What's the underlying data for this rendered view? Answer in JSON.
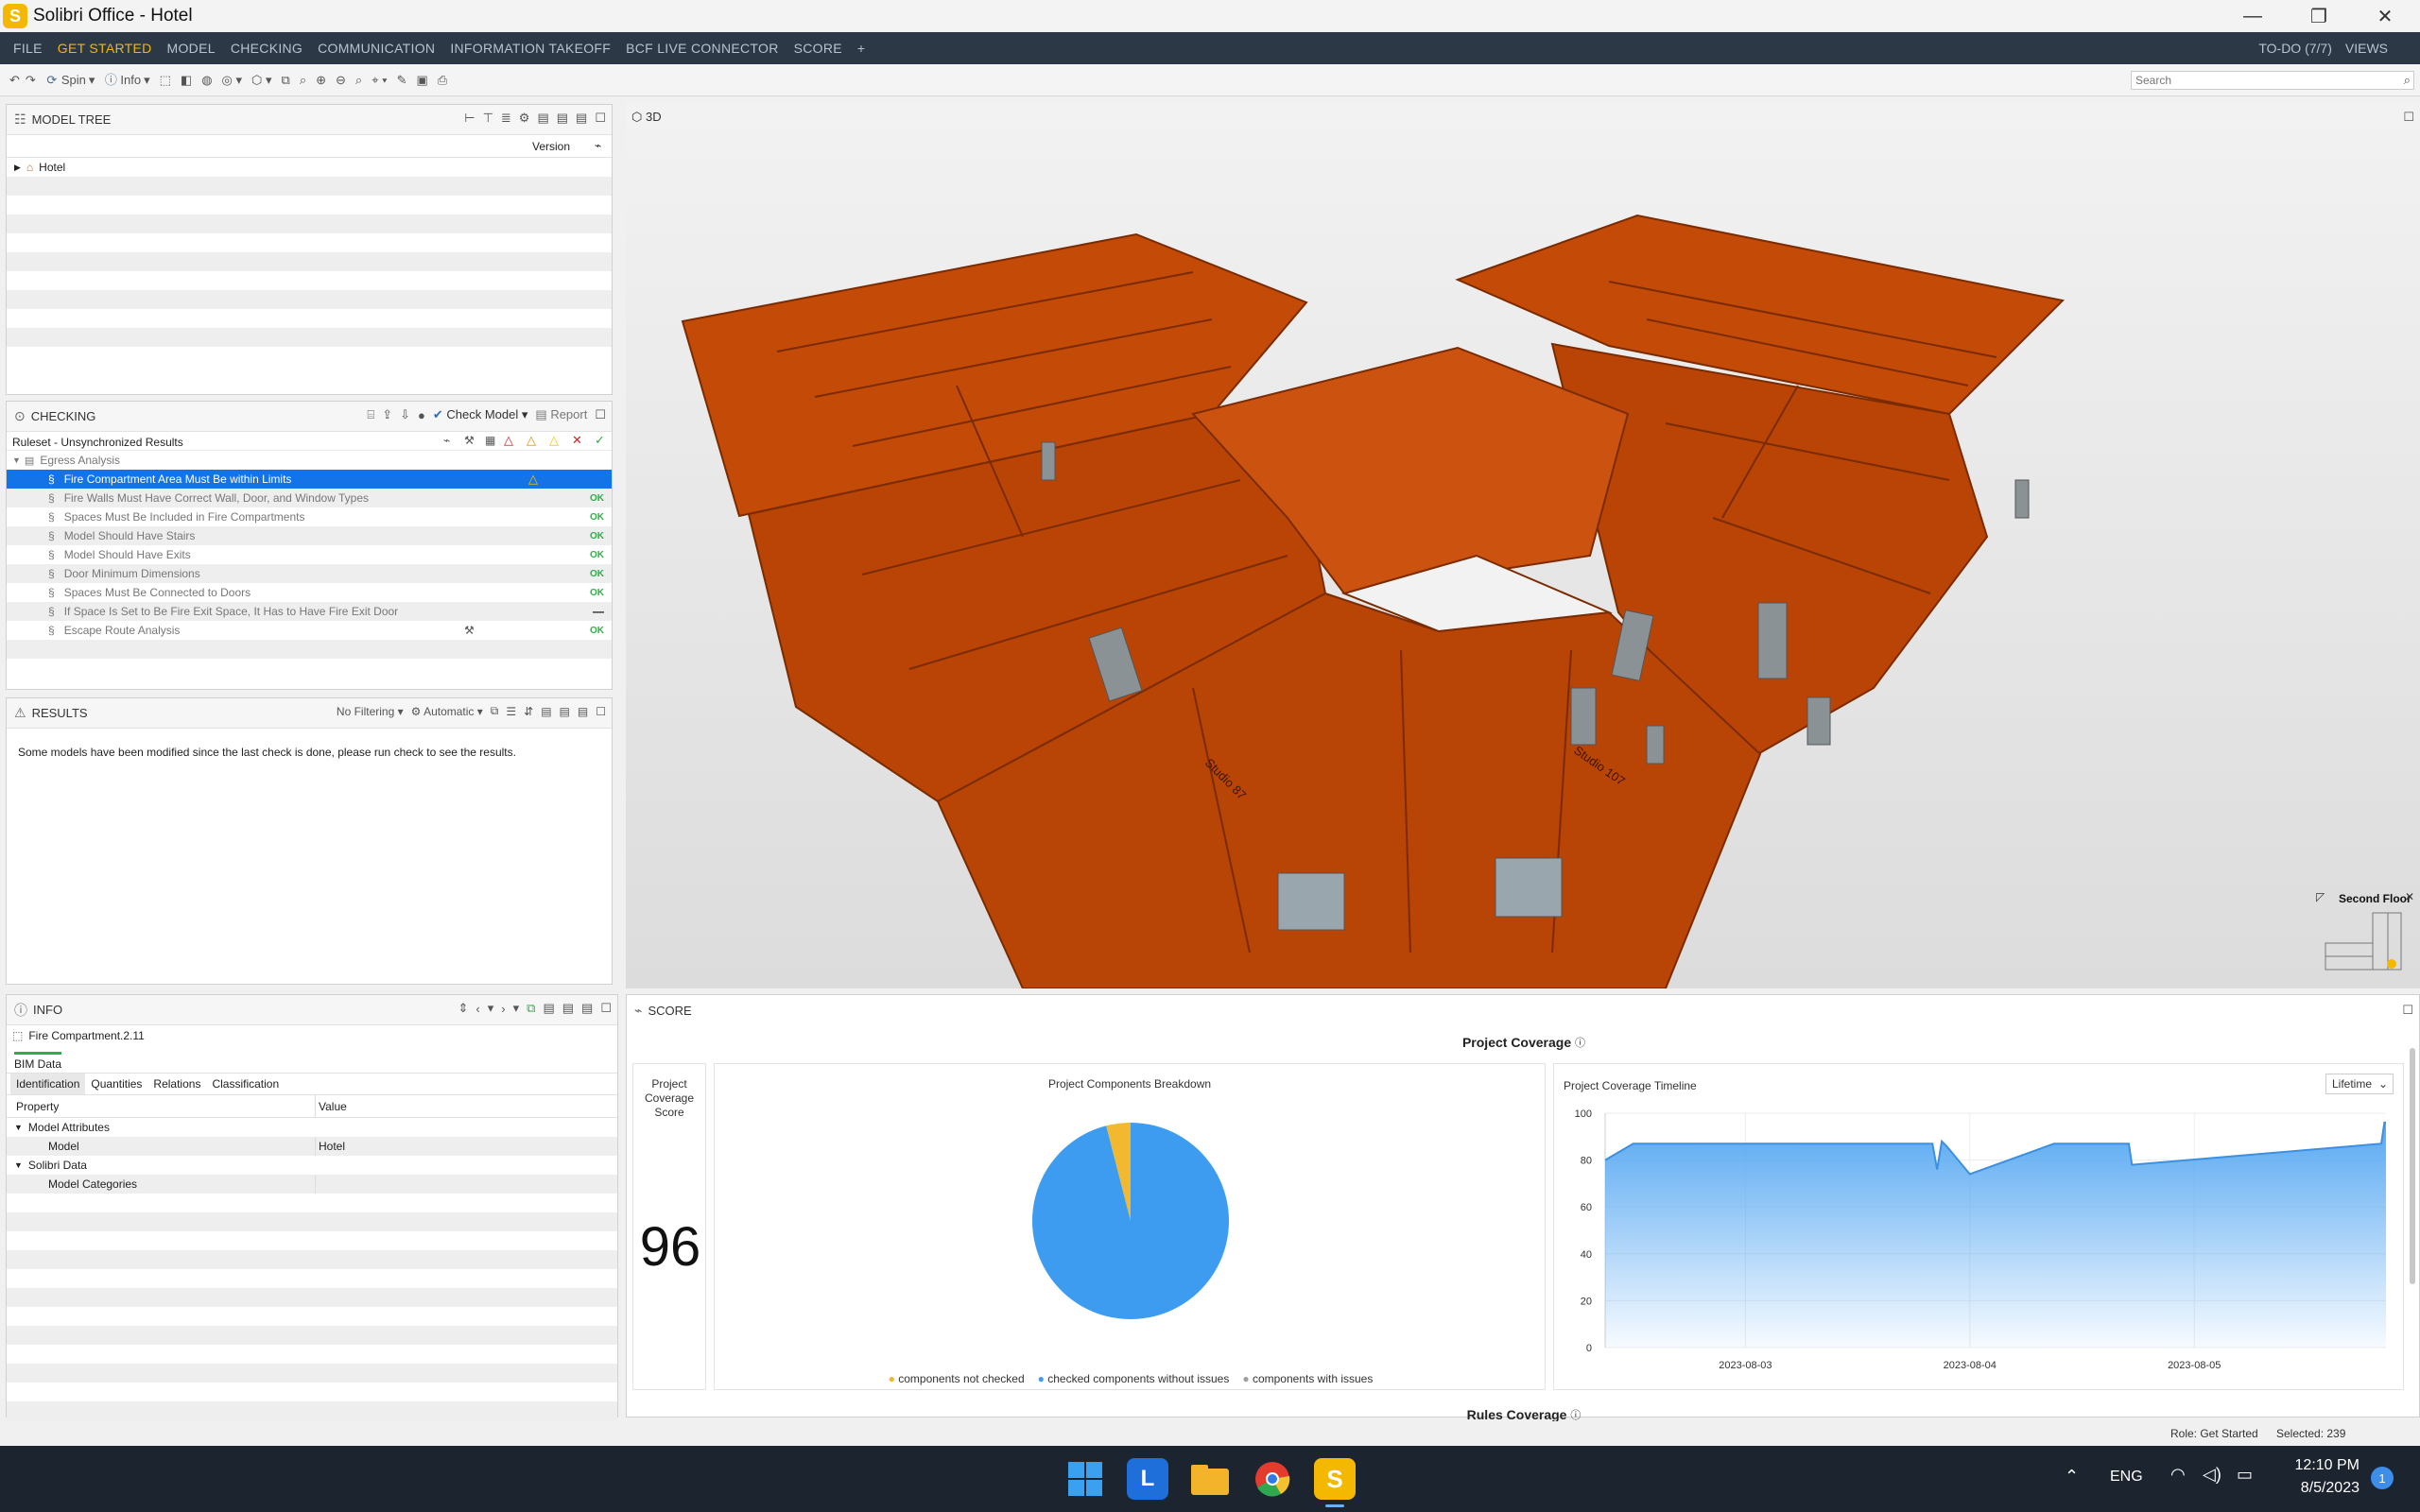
{
  "window": {
    "title": "Solibri Office - Hotel",
    "logo_letter": "S"
  },
  "menu": {
    "items": [
      "FILE",
      "GET STARTED",
      "MODEL",
      "CHECKING",
      "COMMUNICATION",
      "INFORMATION TAKEOFF",
      "BCF LIVE CONNECTOR",
      "SCORE",
      "+"
    ],
    "active": "GET STARTED",
    "todo": "TO-DO (7/7)",
    "views": "VIEWS"
  },
  "toolbar": {
    "spin_label": "Spin",
    "info_label": "Info",
    "search_placeholder": "Search"
  },
  "model_tree": {
    "title": "MODEL TREE",
    "version_header": "Version",
    "root_item": "Hotel"
  },
  "checking": {
    "title": "CHECKING",
    "check_model_label": "Check Model",
    "report_label": "Report",
    "ruleset_label": "Ruleset - Unsynchronized Results",
    "group_label": "Egress Analysis",
    "rules": [
      {
        "label": "Fire Compartment Area Must Be within Limits",
        "status": "△"
      },
      {
        "label": "Fire Walls Must Have Correct Wall, Door, and Window Types",
        "status": "OK"
      },
      {
        "label": "Spaces Must Be Included in Fire Compartments",
        "status": "OK"
      },
      {
        "label": "Model Should Have Stairs",
        "status": "OK"
      },
      {
        "label": "Model Should Have Exits",
        "status": "OK"
      },
      {
        "label": "Door Minimum Dimensions",
        "status": "OK"
      },
      {
        "label": "Spaces Must Be Connected to Doors",
        "status": "OK"
      },
      {
        "label": "If Space Is Set to Be Fire Exit Space, It Has to Have Fire Exit Door",
        "status": "—"
      },
      {
        "label": "Escape Route Analysis",
        "status": "OK"
      }
    ]
  },
  "results": {
    "title": "RESULTS",
    "filter_label": "No Filtering",
    "mode_label": "Automatic",
    "message": "Some models have been modified since the last check is done, please run check to see the results."
  },
  "info": {
    "title": "INFO",
    "selected_item": "Fire Compartment.2.11",
    "bim_tab": "BIM Data",
    "tabs": [
      "Identification",
      "Quantities",
      "Relations",
      "Classification"
    ],
    "col_property": "Property",
    "col_value": "Value",
    "group1": "Model Attributes",
    "model_label": "Model",
    "model_value": "Hotel",
    "group2": "Solibri Data",
    "categories_label": "Model Categories"
  },
  "viewport": {
    "title": "3D",
    "floor_label": "Second Floor",
    "room_labels": [
      "Studio 107",
      "Studio 87"
    ]
  },
  "score": {
    "title": "SCORE",
    "coverage_title": "Project Coverage",
    "score_card_title": "Project Coverage Score",
    "score_value": "96",
    "breakdown_title": "Project Components Breakdown",
    "timeline_title": "Project Coverage Timeline",
    "timeline_range": "Lifetime",
    "rules_coverage": "Rules Coverage",
    "legend": [
      {
        "label": "components not checked",
        "color": "#f2b82f"
      },
      {
        "label": "checked components without issues",
        "color": "#3d9cf0"
      },
      {
        "label": "components with issues",
        "color": "#a0a0a0"
      }
    ]
  },
  "chart_data": [
    {
      "type": "pie",
      "title": "Project Components Breakdown",
      "categories": [
        "components not checked",
        "checked components without issues",
        "components with issues"
      ],
      "values": [
        4,
        96,
        0
      ]
    },
    {
      "type": "area",
      "title": "Project Coverage Timeline",
      "xlabel": "",
      "ylabel": "",
      "x_ticks": [
        "2023-08-03",
        "2023-08-04",
        "2023-08-05"
      ],
      "ylim": [
        0,
        100
      ],
      "y_ticks": [
        0,
        20,
        40,
        60,
        80,
        100
      ],
      "x": [
        "2023-08-02 09:00",
        "2023-08-02 12:00",
        "2023-08-03 12:00",
        "2023-08-03 20:00",
        "2023-08-03 20:30",
        "2023-08-03 21:00",
        "2023-08-03 21:30",
        "2023-08-04 00:00",
        "2023-08-04 09:00",
        "2023-08-04 17:00",
        "2023-08-04 17:20",
        "2023-08-05 20:00",
        "2023-08-05 20:20",
        "2023-08-05 20:30"
      ],
      "values": [
        80,
        87,
        87,
        87,
        76,
        88,
        86,
        74,
        87,
        87,
        78,
        87,
        96,
        96
      ]
    }
  ],
  "status": {
    "role": "Role: Get Started",
    "selected": "Selected: 239"
  },
  "taskbar": {
    "lang": "ENG",
    "time": "12:10 PM",
    "date": "8/5/2023",
    "notif": "1"
  }
}
